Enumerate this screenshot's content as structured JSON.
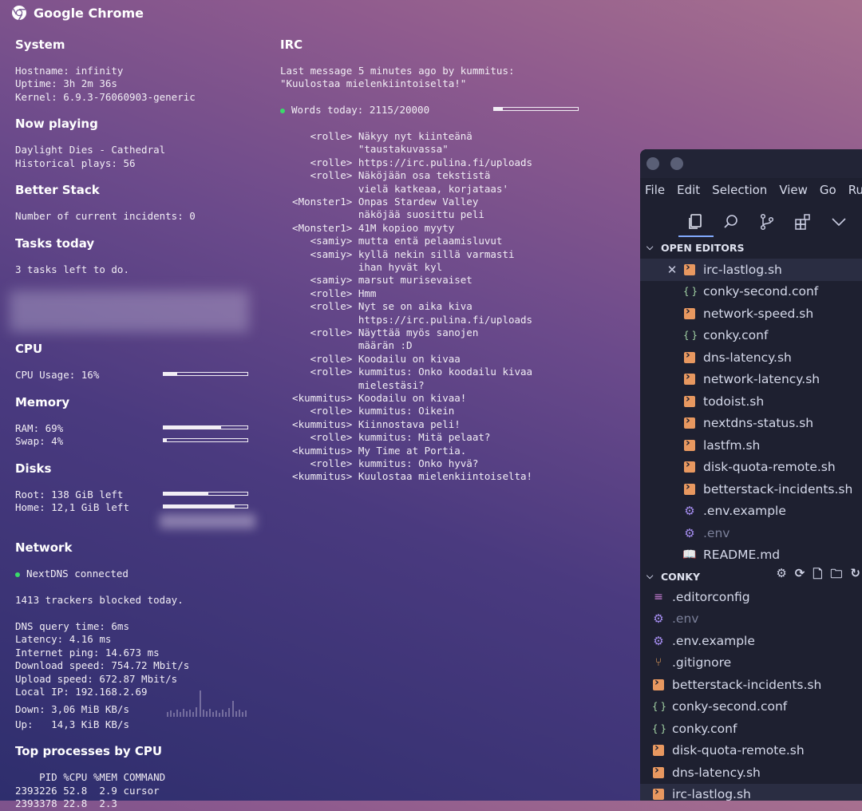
{
  "window_title": "Google Chrome",
  "system": {
    "heading": "System",
    "hostname": "Hostname: infinity",
    "uptime": "Uptime: 3h 2m 36s",
    "kernel": "Kernel: 6.9.3-76060903-generic"
  },
  "now_playing": {
    "heading": "Now playing",
    "track": "Daylight Dies - Cathedral",
    "plays": "Historical plays: 56"
  },
  "better_stack": {
    "heading": "Better Stack",
    "incidents": "Number of current incidents: 0"
  },
  "tasks": {
    "heading": "Tasks today",
    "text": "3 tasks left to do."
  },
  "cpu": {
    "heading": "CPU",
    "usage": "CPU Usage: 16%",
    "usage_fraction": 0.16
  },
  "memory": {
    "heading": "Memory",
    "ram": "RAM: 69%",
    "ram_fraction": 0.69,
    "swap": "Swap: 4%",
    "swap_fraction": 0.04
  },
  "disks": {
    "heading": "Disks",
    "root": "Root: 138 GiB left",
    "root_fraction": 0.53,
    "home": "Home: 12,1 GiB left",
    "home_fraction": 0.85
  },
  "network": {
    "heading": "Network",
    "nextdns": "NextDNS connected",
    "trackers": "1413 trackers blocked today.",
    "dns_query": "DNS query time: 6ms",
    "latency": "Latency: 4.16 ms",
    "ping": "Internet ping: 14.673 ms",
    "download": "Download speed: 754.72 Mbit/s",
    "upload": "Upload speed: 672.87 Mbit/s",
    "local_ip": "Local IP: 192.168.2.69",
    "down": "Down: 3,06 MiB KB/s",
    "up": "Up:   14,3 KiB KB/s"
  },
  "top_processes": {
    "heading": "Top processes by CPU",
    "header": "    PID %CPU %MEM COMMAND",
    "rows": [
      "2393226 52.8  2.9 cursor",
      "2393378 22.8  2.3"
    ]
  },
  "irc": {
    "heading": "IRC",
    "last_message": "Last message 5 minutes ago by kummitus:",
    "quote": "\"Kuulostaa mielenkiintoiselta!\"",
    "words": "Words today: 2115/20000",
    "words_fraction": 0.1058,
    "lines": [
      "     <rolle> Näkyy nyt kiinteänä",
      "             \"taustakuvassa\"",
      "     <rolle> https://irc.pulina.fi/uploads",
      "     <rolle> Näköjään osa tekstistä",
      "             vielä katkeaa, korjataas'",
      "  <Monster1> Onpas Stardew Valley",
      "             näköjää suosittu peli",
      "  <Monster1> 41M kopioo myyty",
      "     <samiy> mutta entä pelaamisluvut",
      "     <samiy> kyllä nekin sillä varmasti",
      "             ihan hyvät kyl",
      "     <samiy> marsut murisevaiset",
      "     <rolle> Hmm",
      "     <rolle> Nyt se on aika kiva",
      "             https://irc.pulina.fi/uploads",
      "     <rolle> Näyttää myös sanojen",
      "             määrän :D",
      "     <rolle> Koodailu on kivaa",
      "     <rolle> kummitus: Onko koodailu kivaa",
      "             mielestäsi?",
      "  <kummitus> Koodailu on kivaa!",
      "     <rolle> kummitus: Oikein",
      "  <kummitus> Kiinnostava peli!",
      "     <rolle> kummitus: Mitä pelaat?",
      "  <kummitus> My Time at Portia.",
      "     <rolle> kummitus: Onko hyvä?",
      "  <kummitus> Kuulostaa mielenkiintoiselta!"
    ]
  },
  "vscode": {
    "menu": [
      "File",
      "Edit",
      "Selection",
      "View",
      "Go",
      "Run"
    ],
    "open_editors_label": "OPEN EDITORS",
    "open_editors": [
      {
        "name": "irc-lastlog.sh",
        "type": "sh",
        "selected": true
      },
      {
        "name": "conky-second.conf",
        "type": "conf"
      },
      {
        "name": "network-speed.sh",
        "type": "sh"
      },
      {
        "name": "conky.conf",
        "type": "conf"
      },
      {
        "name": "dns-latency.sh",
        "type": "sh"
      },
      {
        "name": "network-latency.sh",
        "type": "sh"
      },
      {
        "name": "todoist.sh",
        "type": "sh"
      },
      {
        "name": "nextdns-status.sh",
        "type": "sh"
      },
      {
        "name": "lastfm.sh",
        "type": "sh"
      },
      {
        "name": "disk-quota-remote.sh",
        "type": "sh"
      },
      {
        "name": "betterstack-incidents.sh",
        "type": "sh"
      },
      {
        "name": ".env.example",
        "type": "env"
      },
      {
        "name": ".env",
        "type": "env",
        "dim": true
      },
      {
        "name": "README.md",
        "type": "md"
      }
    ],
    "conky_label": "CONKY",
    "conky_files": [
      {
        "name": ".editorconfig",
        "type": "editorconfig"
      },
      {
        "name": ".env",
        "type": "env",
        "dim": true
      },
      {
        "name": ".env.example",
        "type": "env"
      },
      {
        "name": ".gitignore",
        "type": "git"
      },
      {
        "name": "betterstack-incidents.sh",
        "type": "sh"
      },
      {
        "name": "conky-second.conf",
        "type": "conf"
      },
      {
        "name": "conky.conf",
        "type": "conf"
      },
      {
        "name": "disk-quota-remote.sh",
        "type": "sh"
      },
      {
        "name": "dns-latency.sh",
        "type": "sh"
      },
      {
        "name": "irc-lastlog.sh",
        "type": "sh",
        "selected": true
      }
    ]
  }
}
